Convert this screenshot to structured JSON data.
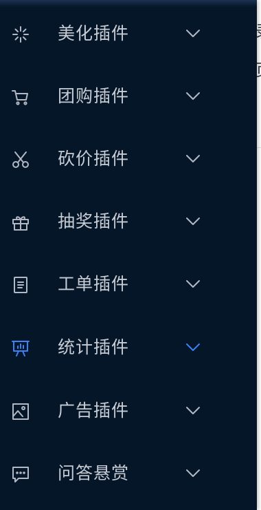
{
  "peek": {
    "line1": "录",
    "line2": "页"
  },
  "menu": {
    "items": [
      {
        "label": "美化插件",
        "icon": "sparkle-icon"
      },
      {
        "label": "团购插件",
        "icon": "cart-icon"
      },
      {
        "label": "砍价插件",
        "icon": "scissors-icon"
      },
      {
        "label": "抽奖插件",
        "icon": "gift-icon"
      },
      {
        "label": "工单插件",
        "icon": "document-icon"
      },
      {
        "label": "统计插件",
        "icon": "presentation-icon",
        "active": true
      },
      {
        "label": "广告插件",
        "icon": "image-icon"
      },
      {
        "label": "问答悬赏",
        "icon": "chat-icon"
      }
    ],
    "active_color": "#3b82f6",
    "background_color": "#061629",
    "text_color": "#c7ccd4"
  }
}
